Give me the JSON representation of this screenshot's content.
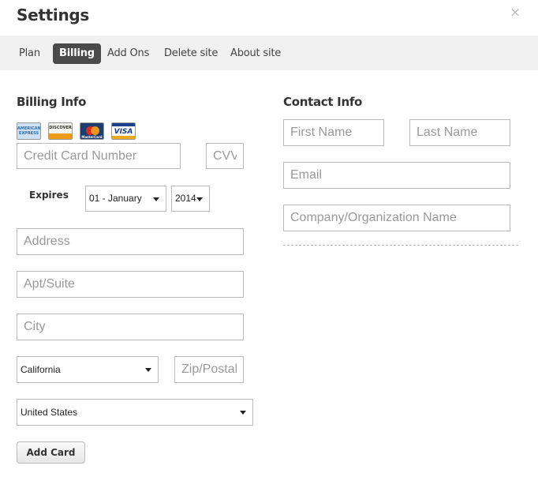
{
  "header": {
    "title": "Settings",
    "close_glyph": "×"
  },
  "tabs": [
    {
      "label": "Plan",
      "active": false
    },
    {
      "label": "Billing",
      "active": true
    },
    {
      "label": "Add Ons",
      "active": false
    },
    {
      "label": "Delete site",
      "active": false
    },
    {
      "label": "About site",
      "active": false
    }
  ],
  "billing": {
    "title": "Billing Info",
    "cards": [
      {
        "name": "amex-card-icon",
        "text": "AMERICAN EXPRESS"
      },
      {
        "name": "discover-card-icon",
        "text": "DISCOVER"
      },
      {
        "name": "mastercard-card-icon",
        "text": "MasterCard"
      },
      {
        "name": "visa-card-icon",
        "text": "VISA"
      }
    ],
    "card_number_placeholder": "Credit Card Number",
    "cvv_placeholder": "CVV",
    "expires_label": "Expires",
    "expires_month": "01 - January",
    "expires_year": "2014",
    "address_placeholder": "Address",
    "apt_placeholder": "Apt/Suite",
    "city_placeholder": "City",
    "state": "California",
    "zip_placeholder": "Zip/Postal",
    "country": "United States",
    "add_card_label": "Add Card"
  },
  "contact": {
    "title": "Contact Info",
    "first_name_placeholder": "First Name",
    "last_name_placeholder": "Last Name",
    "email_placeholder": "Email",
    "company_placeholder": "Company/Organization Name"
  },
  "colors": {
    "tabbar_bg": "#f0f0f0",
    "active_tab_bg": "#4a4a4a",
    "field_border": "#bbbbbb"
  }
}
